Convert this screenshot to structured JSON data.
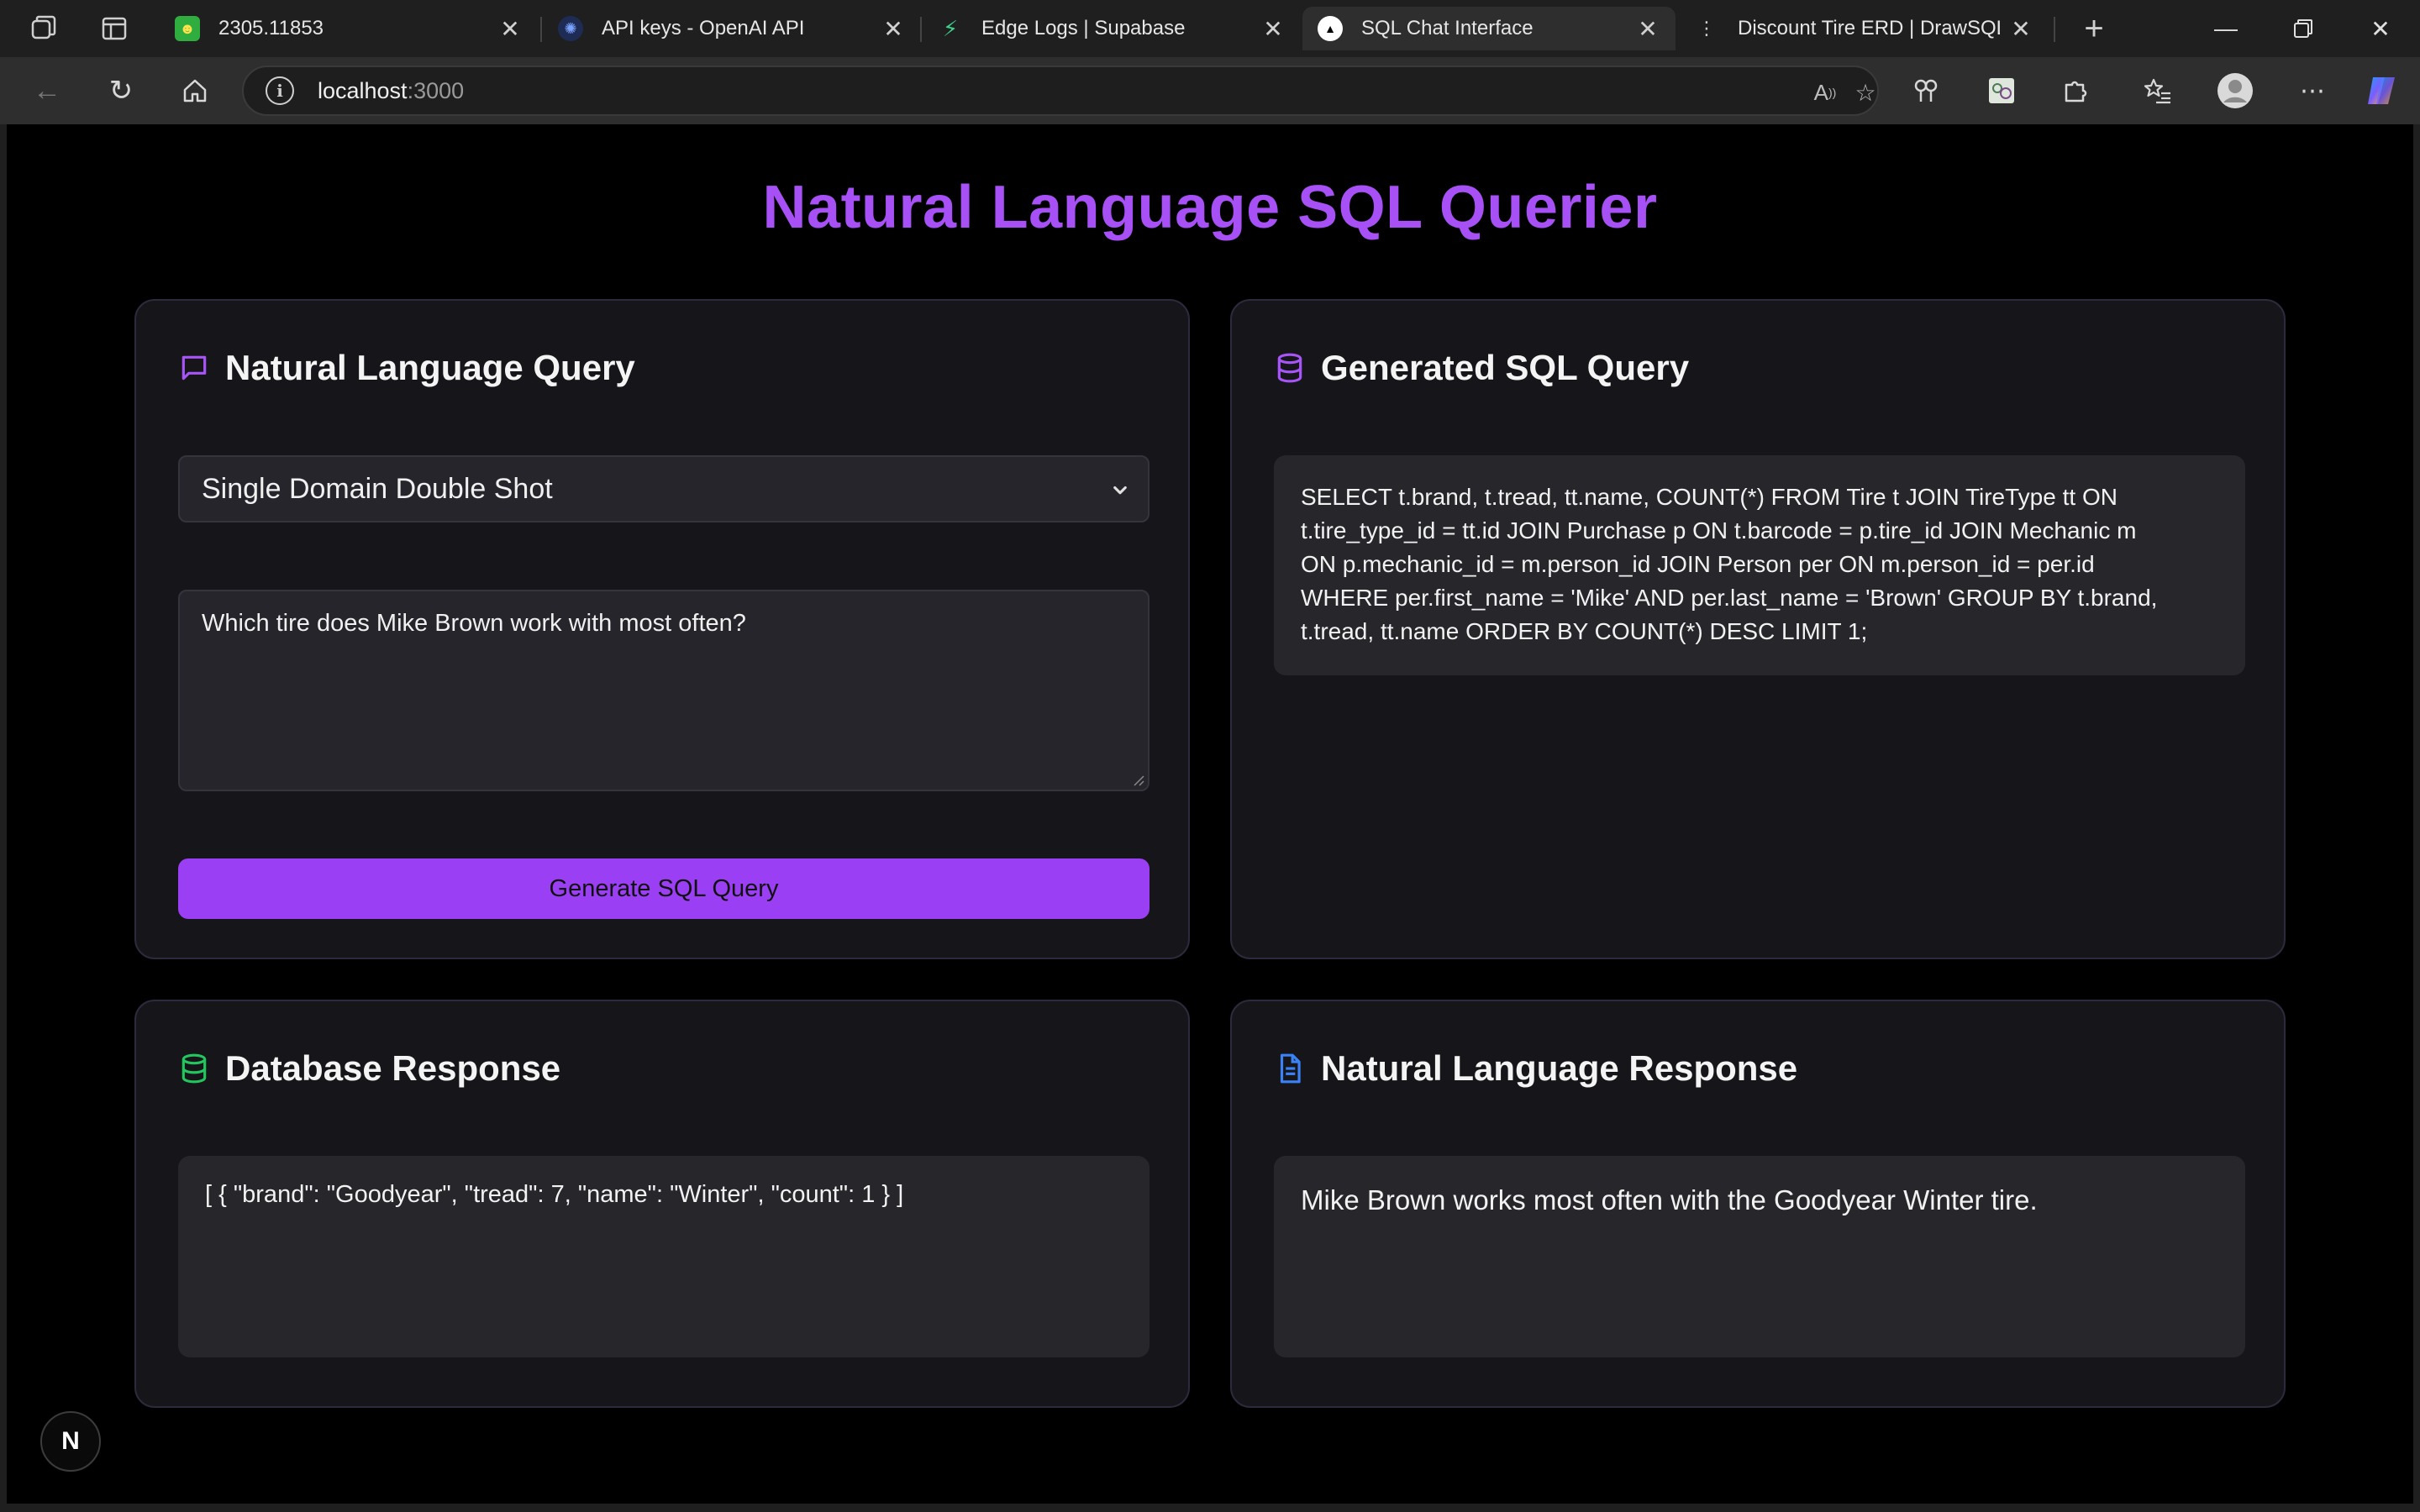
{
  "browser": {
    "tabs": [
      {
        "title": "2305.11853",
        "favicon": "smiley-favicon",
        "active": false
      },
      {
        "title": "API keys - OpenAI API",
        "favicon": "openai-favicon",
        "active": false
      },
      {
        "title": "Edge Logs | Supabase",
        "favicon": "supabase-favicon",
        "active": false
      },
      {
        "title": "SQL Chat Interface",
        "favicon": "vercel-favicon",
        "active": true
      },
      {
        "title": "Discount Tire ERD | DrawSQL",
        "favicon": "drawsql-favicon",
        "active": false
      }
    ],
    "new_tab_symbol": "+",
    "address": {
      "host": "localhost",
      "port": ":3000"
    }
  },
  "page": {
    "title": "Natural Language SQL Querier"
  },
  "query_card": {
    "title": "Natural Language Query",
    "mode_selected": "Single Domain Double Shot",
    "question": "Which tire does Mike Brown work with most often?",
    "button_label": "Generate SQL Query"
  },
  "sql_card": {
    "title": "Generated SQL Query",
    "sql_lines": [
      "SELECT t.brand, t.tread, tt.name, COUNT(*) FROM Tire t JOIN TireType tt ON",
      "t.tire_type_id = tt.id JOIN Purchase p ON t.barcode = p.tire_id JOIN Mechanic m",
      "ON p.mechanic_id = m.person_id JOIN Person per ON m.person_id = per.id",
      "WHERE per.first_name = 'Mike' AND per.last_name = 'Brown' GROUP BY t.brand,",
      "t.tread, tt.name ORDER BY COUNT(*) DESC LIMIT 1;"
    ]
  },
  "db_card": {
    "title": "Database Response",
    "response": "[ { \"brand\": \"Goodyear\", \"tread\": 7, \"name\": \"Winter\", \"count\": 1 } ]"
  },
  "nl_card": {
    "title": "Natural Language Response",
    "response": "Mike Brown works most often with the Goodyear Winter tire."
  },
  "dev_badge": {
    "label": "N"
  },
  "colors": {
    "accent": "#a650f5",
    "button": "#9b3ff5",
    "db_icon": "#22c55e",
    "doc_icon": "#3b82f6",
    "sql_icon": "#a855f7"
  }
}
